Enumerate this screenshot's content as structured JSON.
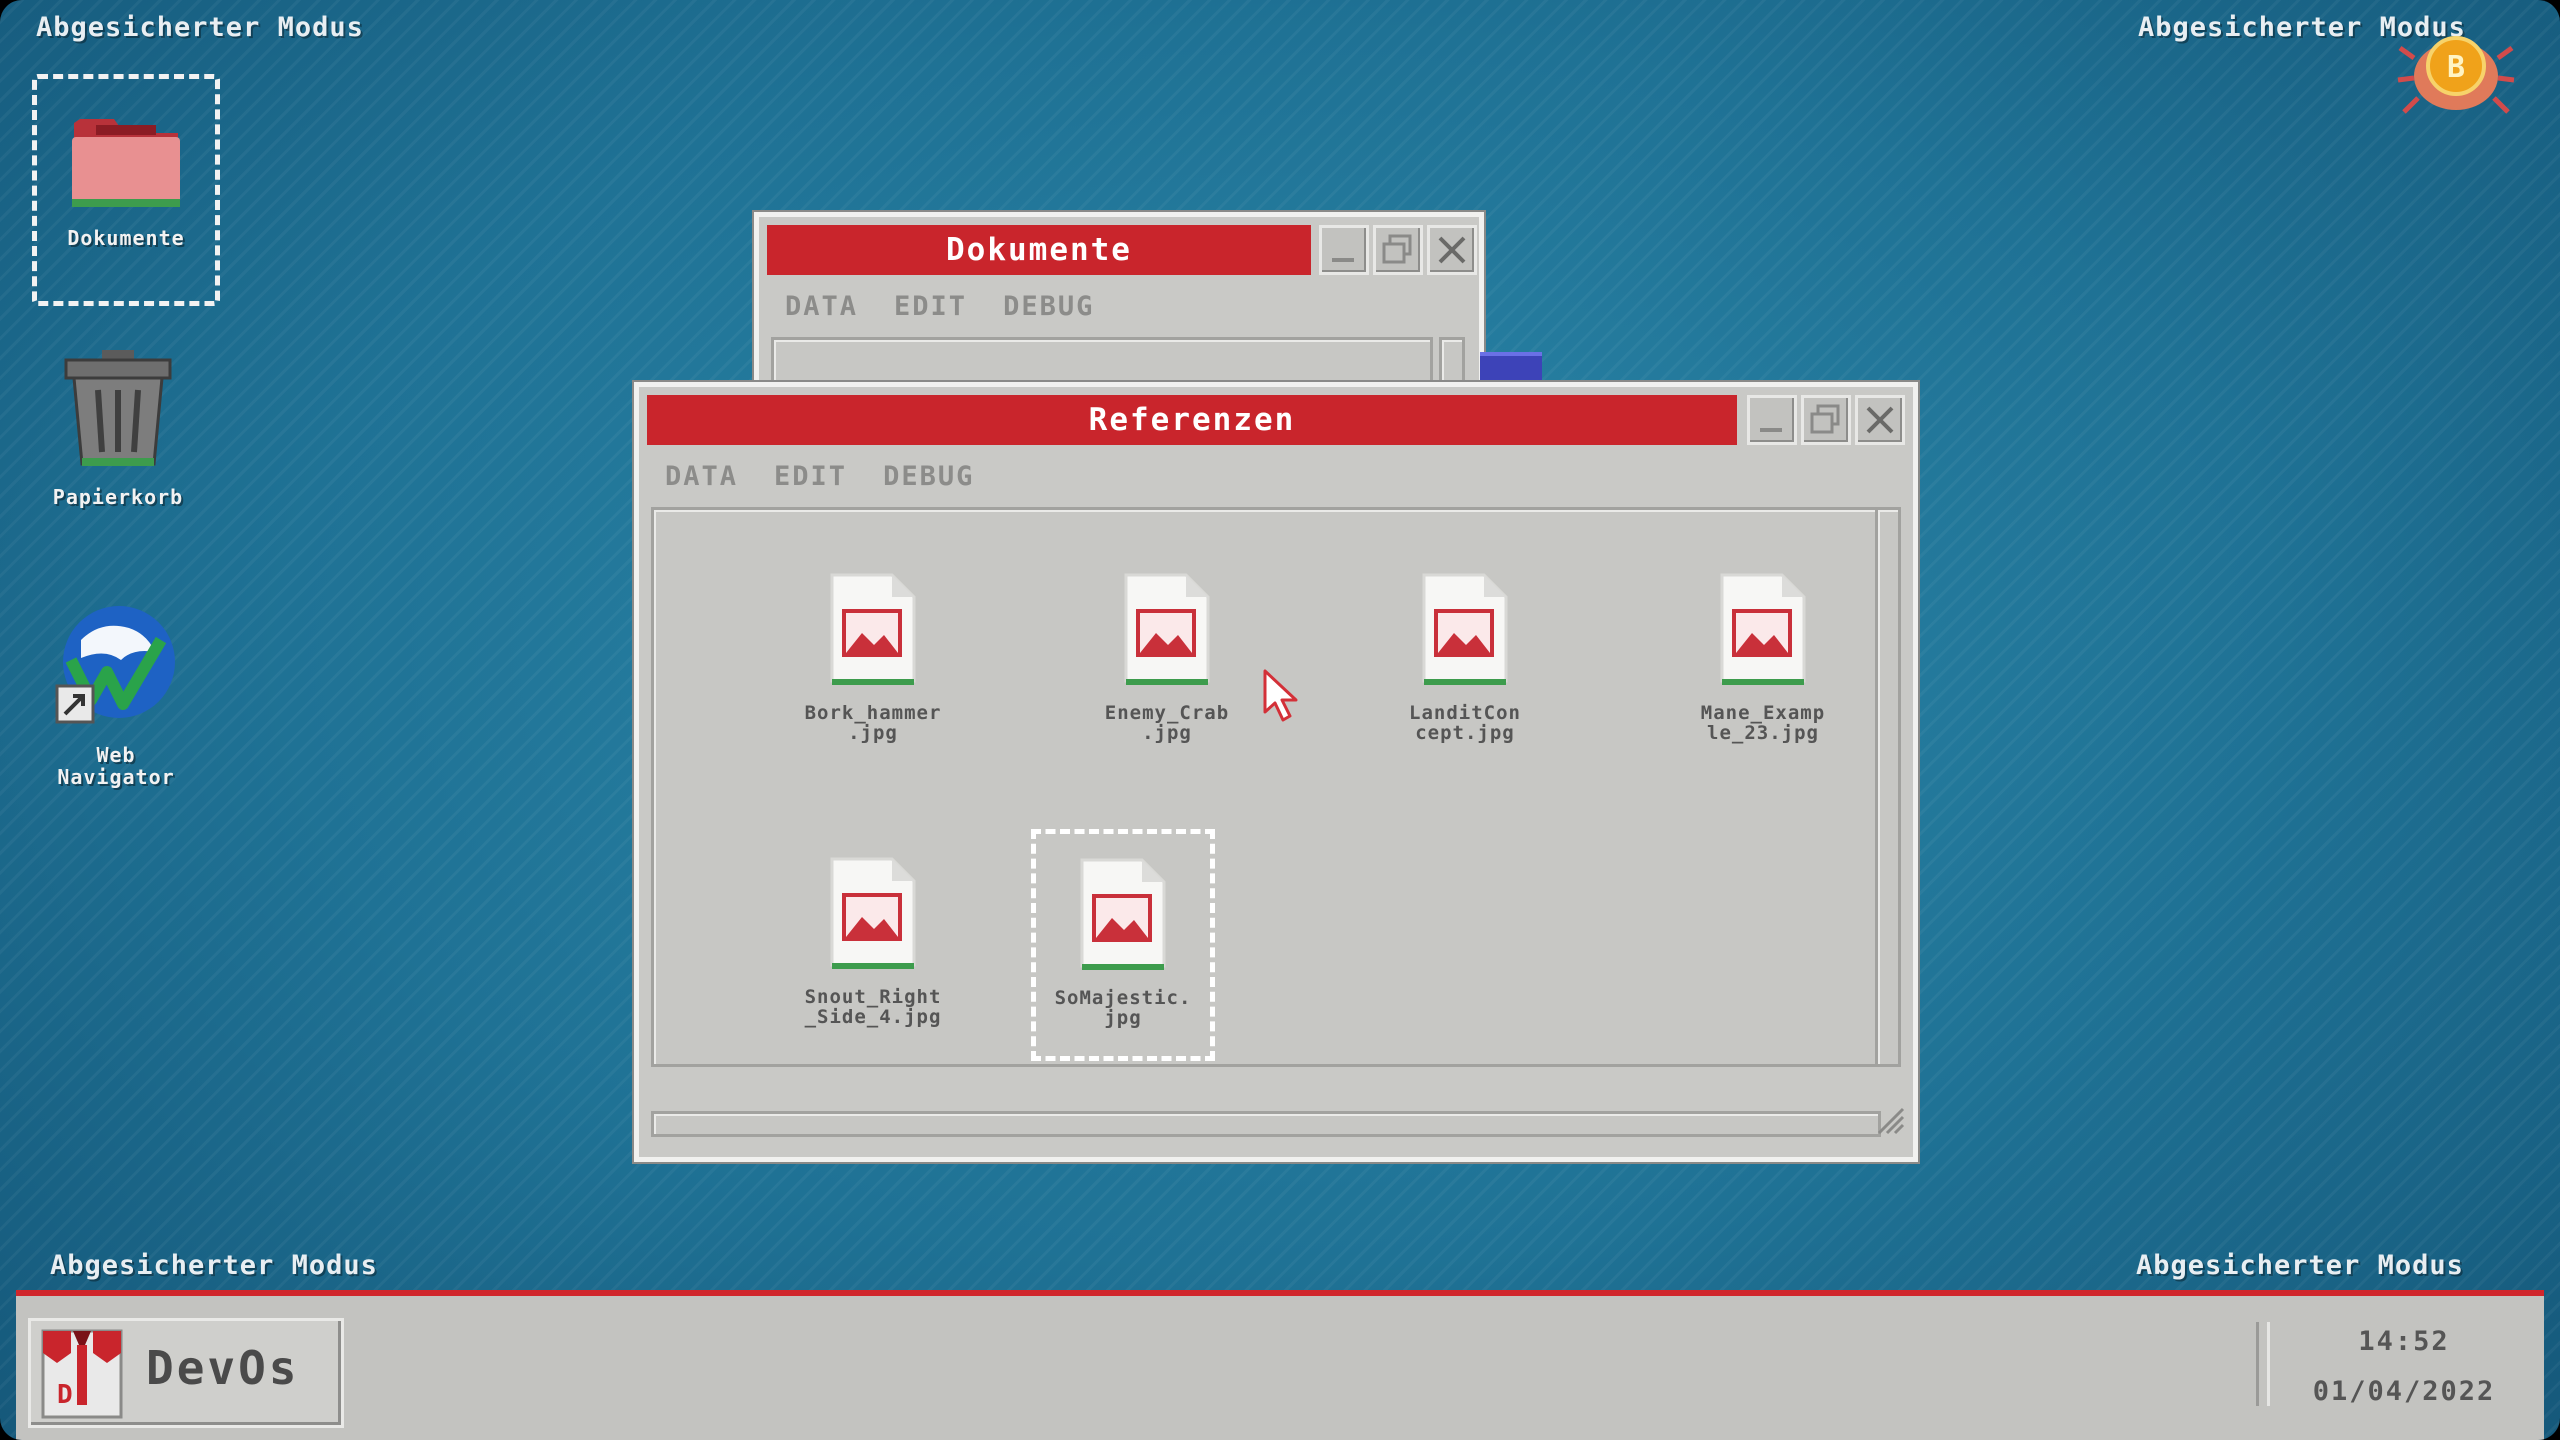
{
  "safe_mode": {
    "top_left": "Abgesicherter Modus",
    "top_right": "Abgesicherter Modus",
    "bottom_left": "Abgesicherter Modus",
    "bottom_right": "Abgesicherter Modus"
  },
  "desktop": {
    "icons": [
      {
        "label": "Dokumente",
        "icon": "folder-icon"
      },
      {
        "label": "Papierkorb",
        "icon": "trash-icon"
      },
      {
        "label": "Web\nNavigator",
        "icon": "globe-icon"
      }
    ]
  },
  "windows": {
    "dokumente": {
      "title": "Dokumente",
      "menu": [
        "DATA",
        "EDIT",
        "DEBUG"
      ]
    },
    "referenzen": {
      "title": "Referenzen",
      "menu": [
        "DATA",
        "EDIT",
        "DEBUG"
      ],
      "files": [
        {
          "name": "Bork_hammer\n.jpg"
        },
        {
          "name": "Enemy_Crab\n.jpg"
        },
        {
          "name": "LanditCon\ncept.jpg"
        },
        {
          "name": "Mane_Examp\nle_23.jpg"
        },
        {
          "name": "Snout_Right\n_Side_4.jpg"
        },
        {
          "name": "SoMajestic.\njpg"
        }
      ]
    }
  },
  "taskbar": {
    "brand": "DevOs",
    "time": "14:52",
    "date": "01/04/2022"
  },
  "colors": {
    "title_bar": "#c9252c",
    "desktop": "#1f7295",
    "window": "#c9c9c6"
  }
}
